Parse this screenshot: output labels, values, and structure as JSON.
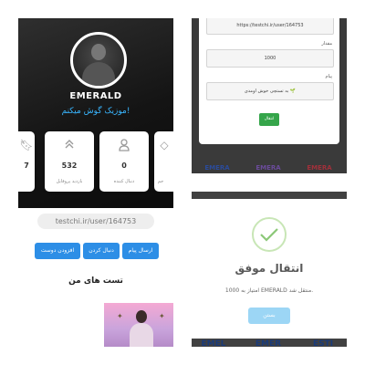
{
  "profile": {
    "username": "EMERALD",
    "bio": "موزیک گوش میکنم!",
    "stats": [
      {
        "value": "7",
        "label": "",
        "icon": "bookmark-icon"
      },
      {
        "value": "532",
        "label": "بازدید پروفایل",
        "icon": "chevron-up-icon"
      },
      {
        "value": "0",
        "label": "دنبال کننده",
        "icon": "user-icon"
      },
      {
        "value": "",
        "label": "جم",
        "icon": "gem-icon"
      }
    ],
    "profile_link": "testchi.ir/user/164753",
    "buttons": {
      "send_message": "ارسال پیام",
      "follow": "دنبال کردن",
      "add_friend": "افزودن دوست"
    },
    "tests_title": "تست های من"
  },
  "transfer_form": {
    "url_value": "https://testchi.ir/user/164753",
    "amount_label": "مقدار",
    "amount_value": "1000",
    "message_label": "پیام",
    "message_value": "به تستچی خوش اومدی 🌱",
    "submit_label": "انتقال",
    "strip_labels": [
      "EMERA",
      "EMERA",
      "EMERA"
    ]
  },
  "success_modal": {
    "title": "انتقال موفق",
    "message": "1000 امتیاز به EMERALD منتقل شد.",
    "close_label": "بستن",
    "strip_labels": [
      "EMEL",
      "EMER",
      "ESTI"
    ]
  },
  "colors": {
    "accent_blue": "#2d8ee6",
    "link_blue": "#39b6ff",
    "success_green": "#35a54a",
    "check_green": "#8cc878",
    "close_button": "#9cd6f5"
  }
}
